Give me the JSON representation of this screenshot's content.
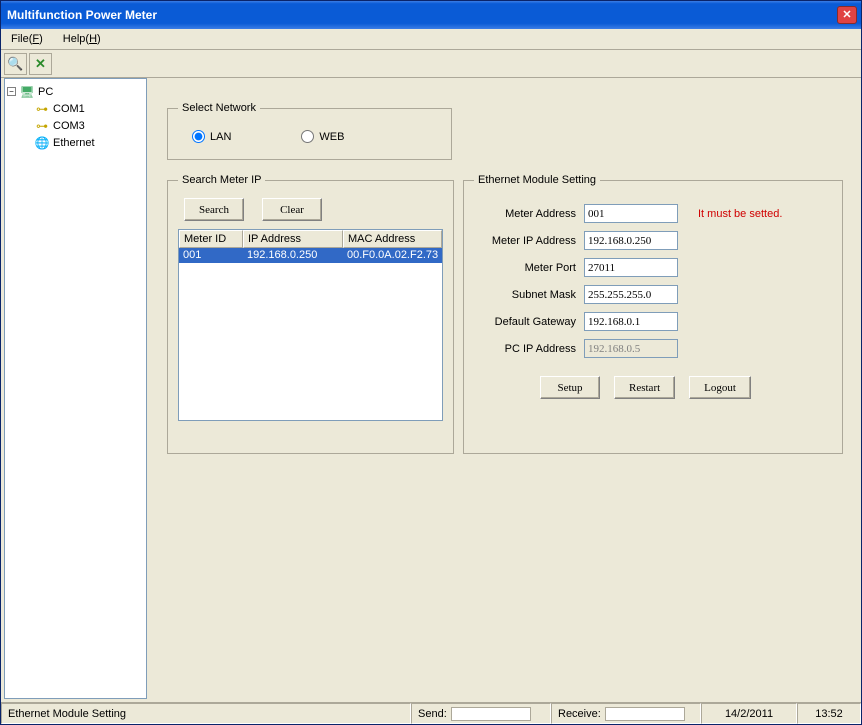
{
  "window": {
    "title": "Multifunction Power Meter"
  },
  "menu": {
    "file": "File(F)",
    "help": "Help(H)"
  },
  "tree": {
    "root": "PC",
    "com1": "COM1",
    "com3": "COM3",
    "ethernet": "Ethernet"
  },
  "selectNetwork": {
    "legend": "Select Network",
    "lan": "LAN",
    "web": "WEB"
  },
  "searchMeter": {
    "legend": "Search Meter IP",
    "searchBtn": "Search",
    "clearBtn": "Clear",
    "cols": {
      "id": "Meter ID",
      "ip": "IP Address",
      "mac": "MAC Address"
    },
    "rows": [
      {
        "id": "001",
        "ip": "192.168.0.250",
        "mac": "00.F0.0A.02.F2.73"
      }
    ]
  },
  "ethSetting": {
    "legend": "Ethernet Module Setting",
    "meterAddressLabel": "Meter Address",
    "meterAddress": "001",
    "warn": "It must be setted.",
    "meterIpLabel": "Meter IP Address",
    "meterIp": "192.168.0.250",
    "meterPortLabel": "Meter Port",
    "meterPort": "27011",
    "subnetLabel": "Subnet Mask",
    "subnet": "255.255.255.0",
    "gatewayLabel": "Default Gateway",
    "gateway": "192.168.0.1",
    "pcIpLabel": "PC IP Address",
    "pcIp": "192.168.0.5",
    "setupBtn": "Setup",
    "restartBtn": "Restart",
    "logoutBtn": "Logout"
  },
  "status": {
    "context": "Ethernet Module Setting",
    "send": "Send:",
    "receive": "Receive:",
    "date": "14/2/2011",
    "time": "13:52"
  }
}
